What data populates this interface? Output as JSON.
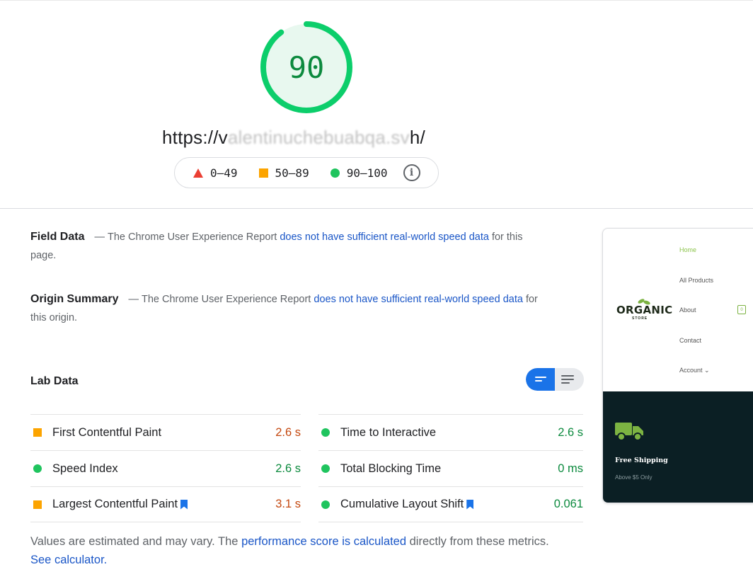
{
  "score": {
    "value": "90",
    "fraction": 0.9,
    "color": "#0cce6b"
  },
  "url": {
    "prefix": "https://v",
    "obscured": "alentinuchebuabqa.sv",
    "suffix": "h/"
  },
  "legend": {
    "items": [
      {
        "icon": "triangle-icon",
        "label": "0–49",
        "color": "#eb3f33"
      },
      {
        "icon": "square-icon",
        "label": "50–89",
        "color": "#fca400"
      },
      {
        "icon": "circle-icon",
        "label": "90–100",
        "color": "#1fc45e"
      }
    ],
    "info_icon": "info-icon",
    "info_glyph": "i"
  },
  "field_data": {
    "title": "Field Data",
    "dash": "—",
    "text_before": "The Chrome User Experience Report",
    "link": "does not have sufficient real-world speed data",
    "text_after": "for this page."
  },
  "origin_summary": {
    "title": "Origin Summary",
    "dash": "—",
    "text_before": "The Chrome User Experience Report",
    "link": "does not have sufficient real-world speed data",
    "text_after": "for this origin."
  },
  "lab_data": {
    "title": "Lab Data",
    "view_toggle": {
      "active": "summary",
      "icons": [
        "summary-view-icon",
        "list-view-icon"
      ]
    },
    "metrics_left": [
      {
        "name": "First Contentful Paint",
        "value": "2.6 s",
        "status": "orange",
        "bookmark": false
      },
      {
        "name": "Speed Index",
        "value": "2.6 s",
        "status": "green",
        "bookmark": false
      },
      {
        "name": "Largest Contentful Paint",
        "value": "3.1 s",
        "status": "orange",
        "bookmark": true
      }
    ],
    "metrics_right": [
      {
        "name": "Time to Interactive",
        "value": "2.6 s",
        "status": "green",
        "bookmark": false
      },
      {
        "name": "Total Blocking Time",
        "value": "0 ms",
        "status": "green",
        "bookmark": false
      },
      {
        "name": "Cumulative Layout Shift",
        "value": "0.061",
        "status": "green",
        "bookmark": true
      }
    ]
  },
  "footnote": {
    "text_before": "Values are estimated and may vary. The",
    "link1": "performance score is calculated",
    "text_middle": "directly from these metrics.",
    "link2": "See calculator."
  },
  "screenshot": {
    "logo_text": "ORGANIC",
    "logo_sub": "STORE",
    "nav": [
      "Home",
      "All Products",
      "About",
      "Contact",
      "Account ⌄"
    ],
    "cart_count": "0",
    "banner_title": "Free Shipping",
    "banner_sub": "Above $5 Only",
    "accent_color": "#7cb342",
    "banner_bg": "#0b1f24"
  }
}
